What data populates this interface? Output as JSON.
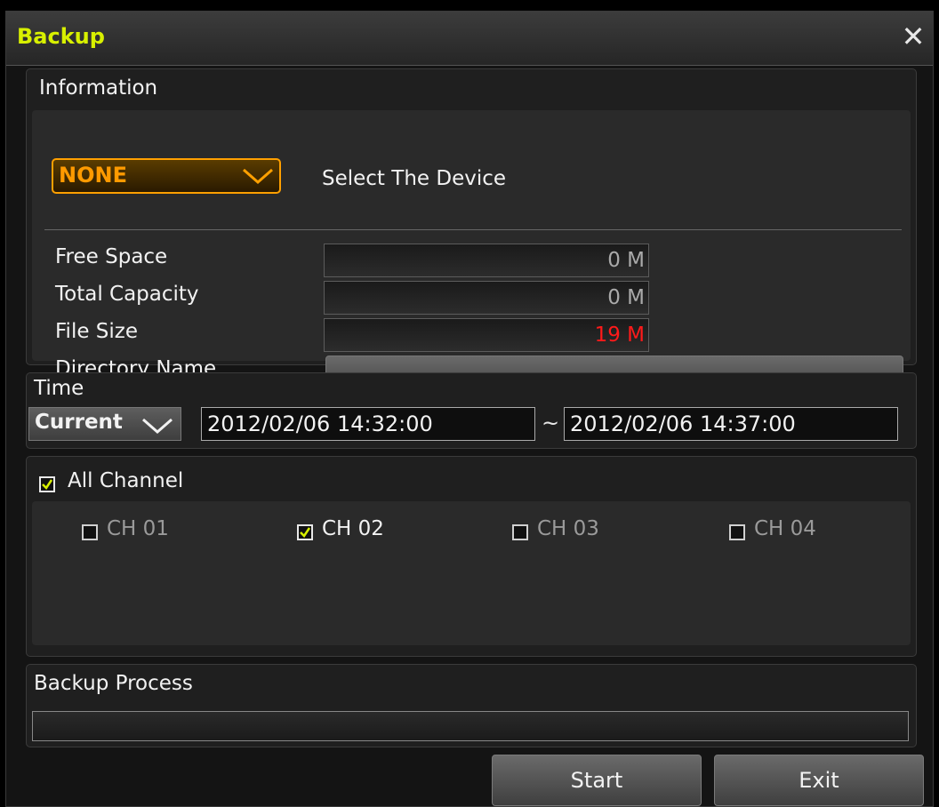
{
  "window": {
    "title": "Backup"
  },
  "information": {
    "heading": "Information",
    "device": {
      "value": "NONE",
      "hint": "Select The Device"
    },
    "rows": [
      {
        "label": "Free Space",
        "value": "0 M"
      },
      {
        "label": "Total Capacity",
        "value": "0 M"
      },
      {
        "label": "File Size",
        "value": "19 M"
      },
      {
        "label": "Directory Name",
        "value": ""
      }
    ]
  },
  "time": {
    "heading": "Time",
    "mode": "Current",
    "start": "2012/02/06  14:32:00",
    "separator": "~",
    "end": "2012/02/06  14:37:00"
  },
  "channels": {
    "all_label": "All Channel",
    "all_checked": true,
    "items": [
      {
        "label": "CH 01",
        "checked": false
      },
      {
        "label": "CH 02",
        "checked": true
      },
      {
        "label": "CH 03",
        "checked": false
      },
      {
        "label": "CH 04",
        "checked": false
      }
    ]
  },
  "process": {
    "heading": "Backup Process",
    "progress": 0
  },
  "buttons": {
    "start": "Start",
    "exit": "Exit"
  },
  "colors": {
    "accent": "#d8f000",
    "device_border": "#ffa000",
    "file_size": "#ff1a1a",
    "check": "#d8f000"
  },
  "icons": {
    "close": "close-icon",
    "dropdown": "chevron-down-icon",
    "checkbox": "checkbox-icon"
  }
}
